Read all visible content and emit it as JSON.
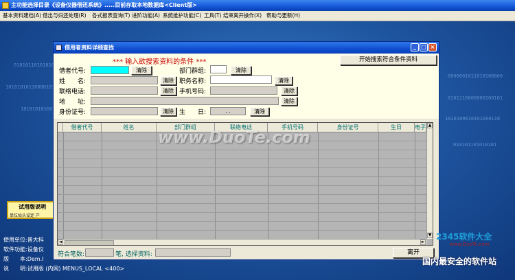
{
  "window": {
    "title": "主功能选择目录《设备仪器借还系统》.....目前存取本地数据库<Client版>"
  },
  "menubar": [
    "基本资料建档(A)",
    "借出与归还处理(R)",
    "各式报表查询(T)",
    "进阶功能(A)",
    "系统维护功能(C)",
    "工具(T)",
    "结束离开操作(X)",
    "帮助与更新(H)"
  ],
  "desktop": {
    "trial_title": "试用版说明",
    "trial_sub": "单位抬头设定 产",
    "info_lines": [
      {
        "label": "使用单位:",
        "value": "普大科"
      },
      {
        "label": "软件功能:",
        "value": "设备仪"
      },
      {
        "label": "版　　本:",
        "value": "Dem.I"
      },
      {
        "label": "说　　明:",
        "value": "试用版 (内网) MENUS_LOCAL <400>"
      }
    ],
    "binary_text": [
      "01010110101010101",
      "101010101100001010101",
      "1010101010011100100001",
      "0000001011010100000",
      "0101110000000100101",
      "1010100010101000110",
      "010101101010101"
    ]
  },
  "dialog": {
    "title": "借用者资料详细查找",
    "prompt": "*** 输入欲搜索资料的条件 ***",
    "search_button": "开始搜索符合条件资料",
    "clear_label": "清除",
    "fields": {
      "borrower_id": "借者代号:",
      "name": "姓　　名:",
      "phone": "联络电话:",
      "address": "地　　址:",
      "id_number": "身份证号:",
      "department": "部门群组:",
      "position": "职务名称:",
      "mobile": "手机号码:",
      "birthday": "生　　日:",
      "birthday_value": ".  ."
    },
    "table": {
      "columns": [
        "借者代号",
        "姓名",
        "部门群组",
        "联络电话",
        "手机号码",
        "身份证号",
        "生日",
        "电子"
      ]
    },
    "status": {
      "count_label": "符合笔数:",
      "count_value": "",
      "selected_label": "笔, 选择资料:",
      "selected_value": "",
      "exit_button": "离开"
    }
  },
  "watermark": {
    "text": "www.DuoTe.com"
  },
  "logo": {
    "name": "2345软件大全",
    "url": "www.DuoTe.com",
    "slogan": "国内最安全的软件站"
  },
  "colors": {
    "titlebar": "#1457d8",
    "desktop": "#1e559f",
    "prompt": "#c80000",
    "highlight_field": "#00ffff"
  }
}
